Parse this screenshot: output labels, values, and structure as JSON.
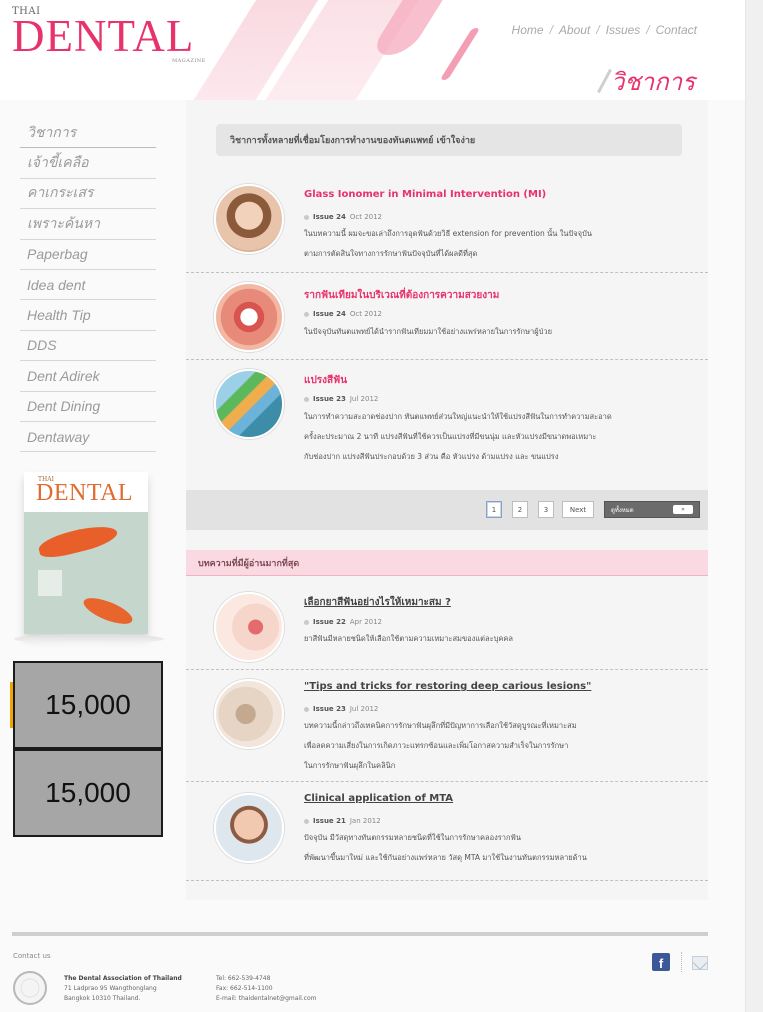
{
  "header": {
    "logo_thai": "THAI",
    "logo_main": "DENTAL",
    "logo_sub": "MAGAZINE",
    "nav": [
      "Home",
      "About",
      "Issues",
      "Contact"
    ],
    "nav_separator": "/",
    "section_title": "วิชาการ",
    "accent_color": "#e8326b"
  },
  "sidebar": {
    "items": [
      "วิชาการ",
      "เจ้าขี้เคลือ",
      "คาเกระเสร",
      "เพราะค้นหา",
      "Paperbag",
      "Idea dent",
      "Health Tip",
      "DDS",
      "Dent Adirek",
      "Dent Dining",
      "Dentaway"
    ],
    "magazine": {
      "thai": "THAI",
      "title": "DENTAL"
    },
    "counters": [
      "15,000",
      "15,000"
    ]
  },
  "main": {
    "intro": "วิชาการทั้งหลายที่เชื่อมโยงการทำงานของทันตแพทย์ เข้าใจง่าย",
    "articles": [
      {
        "title": "Glass Ionomer in Minimal Intervention (MI)",
        "issue": "Issue 24",
        "date": "Oct 2012",
        "desc": [
          "ในบทความนี้ ผมจะขอเล่าถึงการอุดฟันด้วยวิธี extension for prevention นั้น ในปัจจุบัน",
          "ตามการตัดสินใจทางการรักษาฟันปัจจุบันที่ได้ผลดีที่สุด"
        ]
      },
      {
        "title": "รากฟันเทียมในบริเวณที่ต้องการความสวยงาม",
        "issue": "Issue 24",
        "date": "Oct 2012",
        "desc": [
          "ในปัจจุบันทันตแพทย์ได้นำรากฟันเทียมมาใช้อย่างแพร่หลายในการรักษาผู้ป่วย"
        ]
      },
      {
        "title": "แปรงสีฟัน",
        "issue": "Issue 23",
        "date": "Jul 2012",
        "desc": [
          "ในการทำความสะอาดช่องปาก ทันตแพทย์ส่วนใหญ่แนะนำให้ใช้แปรงสีฟันในการทำความสะอาด",
          "ครั้งละประมาณ 2 นาที แปรงสีฟันที่ใช้ควรเป็นแปรงที่มีขนนุ่ม และหัวแปรงมีขนาดพอเหมาะ",
          "กับช่องปาก แปรงสีฟันประกอบด้วย 3 ส่วน คือ หัวแปรง ด้ามแปรง และ ขนแปรง"
        ]
      }
    ],
    "pagination": {
      "pages": [
        "1",
        "2",
        "3"
      ],
      "next": "Next",
      "view_all": "ดูทั้งหมด",
      "view_all_arrow": "»"
    },
    "popular_title": "บทความที่มีผู้อ่านมากที่สุด",
    "popular": [
      {
        "title": "เลือกยาสีฟันอย่างไรให้เหมาะสม ?",
        "issue": "Issue 22",
        "date": "Apr 2012",
        "desc": [
          "ยาสีฟันมีหลายชนิดให้เลือกใช้ตามความเหมาะสมของแต่ละบุคคล"
        ]
      },
      {
        "title": "\"Tips and tricks for restoring deep carious lesions\"",
        "issue": "Issue 23",
        "date": "Jul 2012",
        "desc": [
          "บทความนี้กล่าวถึงเทคนิคการรักษาฟันผุลึกที่มีปัญหาการเลือกใช้วัสดุบูรณะที่เหมาะสม",
          "เพื่อลดความเสี่ยงในการเกิดภาวะแทรกซ้อนและเพิ่มโอกาสความสำเร็จในการรักษา",
          "ในการรักษาฟันผุลึกในคลินิก"
        ]
      },
      {
        "title": "Clinical application of MTA",
        "issue": "Issue 21",
        "date": "Jan 2012",
        "desc": [
          "ปัจจุบัน มีวัสดุทางทันตกรรมหลายชนิดที่ใช้ในการรักษาคลองรากฟัน",
          "ที่พัฒนาขึ้นมาใหม่ และใช้กันอย่างแพร่หลาย วัสดุ MTA มาใช้ในงานทันตกรรมหลายด้าน"
        ]
      }
    ]
  },
  "footer": {
    "contact_label": "Contact us",
    "org_name": "The Dental Association of Thailand",
    "address_1": "71 Ladprao 95 Wangthonglang",
    "address_2": "Bangkok 10310 Thailand.",
    "tel": "Tel: 662-539-4748",
    "fax": "Fax: 662-514-1100",
    "email": "E-mail: thaidentalnet@gmail.com"
  }
}
